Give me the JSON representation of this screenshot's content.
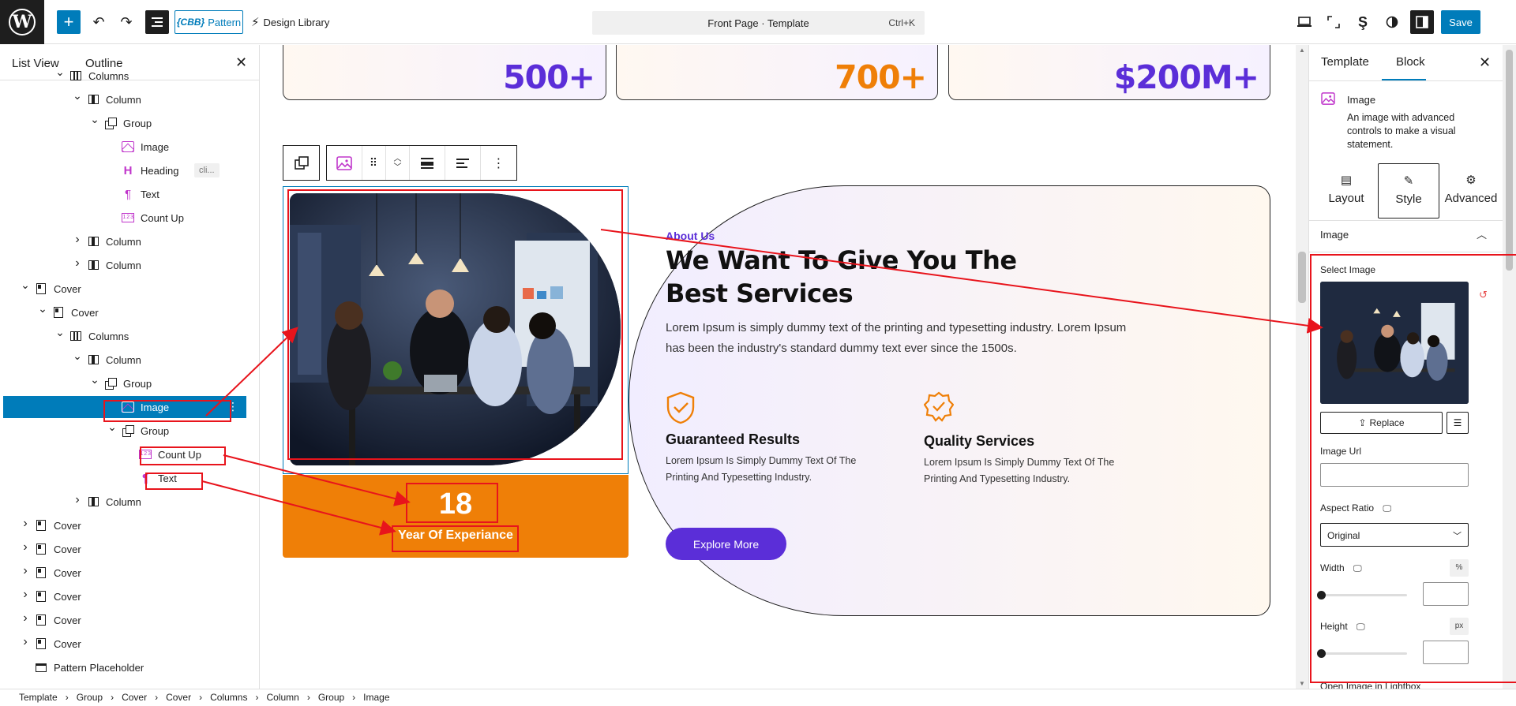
{
  "topbar": {
    "logo_letter": "W",
    "pattern_label": "Pattern",
    "pattern_prefix": "{CBB}",
    "design_library_label": "Design Library",
    "document_title": "Front Page · Template",
    "shortcut": "Ctrl+K",
    "save_label": "Save"
  },
  "list_view": {
    "tab_list": "List View",
    "tab_outline": "Outline",
    "rows": [
      {
        "label": "Columns",
        "depth": 2,
        "icon": "columns",
        "chevron": "down"
      },
      {
        "label": "Column",
        "depth": 3,
        "icon": "column",
        "chevron": "down"
      },
      {
        "label": "Group",
        "depth": 4,
        "icon": "group",
        "chevron": "down"
      },
      {
        "label": "Image",
        "depth": 5,
        "icon": "image",
        "chevron": ""
      },
      {
        "label": "Heading",
        "depth": 5,
        "icon": "heading",
        "chevron": "",
        "badge": "cli..."
      },
      {
        "label": "Text",
        "depth": 5,
        "icon": "paragraph",
        "chevron": ""
      },
      {
        "label": "Count Up",
        "depth": 5,
        "icon": "countup",
        "chevron": ""
      },
      {
        "label": "Column",
        "depth": 3,
        "icon": "column",
        "chevron": "right"
      },
      {
        "label": "Column",
        "depth": 3,
        "icon": "column",
        "chevron": "right"
      },
      {
        "label": "Cover",
        "depth": 0,
        "icon": "cover",
        "chevron": "down"
      },
      {
        "label": "Cover",
        "depth": 1,
        "icon": "cover",
        "chevron": "down"
      },
      {
        "label": "Columns",
        "depth": 2,
        "icon": "columns",
        "chevron": "down"
      },
      {
        "label": "Column",
        "depth": 3,
        "icon": "column",
        "chevron": "down"
      },
      {
        "label": "Group",
        "depth": 4,
        "icon": "group",
        "chevron": "down"
      },
      {
        "label": "Image",
        "depth": 5,
        "icon": "image",
        "chevron": "",
        "selected": true
      },
      {
        "label": "Group",
        "depth": 5,
        "icon": "group",
        "chevron": "down"
      },
      {
        "label": "Count Up",
        "depth": 6,
        "icon": "countup",
        "chevron": ""
      },
      {
        "label": "Text",
        "depth": 6,
        "icon": "paragraph",
        "chevron": ""
      },
      {
        "label": "Column",
        "depth": 3,
        "icon": "column",
        "chevron": "right"
      },
      {
        "label": "Cover",
        "depth": 0,
        "icon": "cover",
        "chevron": "right"
      },
      {
        "label": "Cover",
        "depth": 0,
        "icon": "cover",
        "chevron": "right"
      },
      {
        "label": "Cover",
        "depth": 0,
        "icon": "cover",
        "chevron": "right"
      },
      {
        "label": "Cover",
        "depth": 0,
        "icon": "cover",
        "chevron": "right"
      },
      {
        "label": "Cover",
        "depth": 0,
        "icon": "cover",
        "chevron": "right"
      },
      {
        "label": "Cover",
        "depth": 0,
        "icon": "cover",
        "chevron": "right"
      },
      {
        "label": "Pattern Placeholder",
        "depth": 0,
        "icon": "placeholder",
        "chevron": ""
      }
    ]
  },
  "canvas": {
    "stats": [
      {
        "value": "500+",
        "color": "#5b2ed8"
      },
      {
        "value": "700+",
        "color": "#ef7f07"
      },
      {
        "value": "$200M+",
        "color": "#5b2ed8"
      }
    ],
    "counter_number": "18",
    "counter_label": "Year Of Experiance",
    "about_subtitle": "About Us",
    "about_heading": "We Want To Give You The Best Services",
    "about_paragraph": "Lorem Ipsum is simply dummy text of the printing and typesetting industry. Lorem Ipsum has been the industry's standard dummy text ever since the 1500s.",
    "features": [
      {
        "title": "Guaranteed Results",
        "text": "Lorem Ipsum Is Simply Dummy Text Of The Printing And Typesetting Industry.",
        "icon": "shield-check-icon"
      },
      {
        "title": "Quality Services",
        "text": "Lorem Ipsum Is Simply Dummy Text Of The Printing And Typesetting Industry.",
        "icon": "award-badge-icon"
      }
    ],
    "explore_label": "Explore More",
    "accent_purple": "#5b2ed8",
    "accent_orange": "#ef7f07"
  },
  "settings": {
    "tab_template": "Template",
    "tab_block": "Block",
    "block_title": "Image",
    "block_description": "An image with advanced controls to make a visual statement.",
    "style_tabs": [
      "Layout",
      "Style",
      "Advanced"
    ],
    "section_title": "Image",
    "select_image_label": "Select Image",
    "replace_label": "Replace",
    "image_url_label": "Image Url",
    "image_url_value": "",
    "aspect_ratio_label": "Aspect Ratio",
    "aspect_ratio_value": "Original",
    "width_label": "Width",
    "width_unit": "%",
    "width_value": "",
    "height_label": "Height",
    "height_unit": "px",
    "height_value": "",
    "lightbox_label": "Open Image in Lightbox"
  },
  "breadcrumb": [
    "Template",
    "Group",
    "Cover",
    "Cover",
    "Columns",
    "Column",
    "Group",
    "Image"
  ]
}
